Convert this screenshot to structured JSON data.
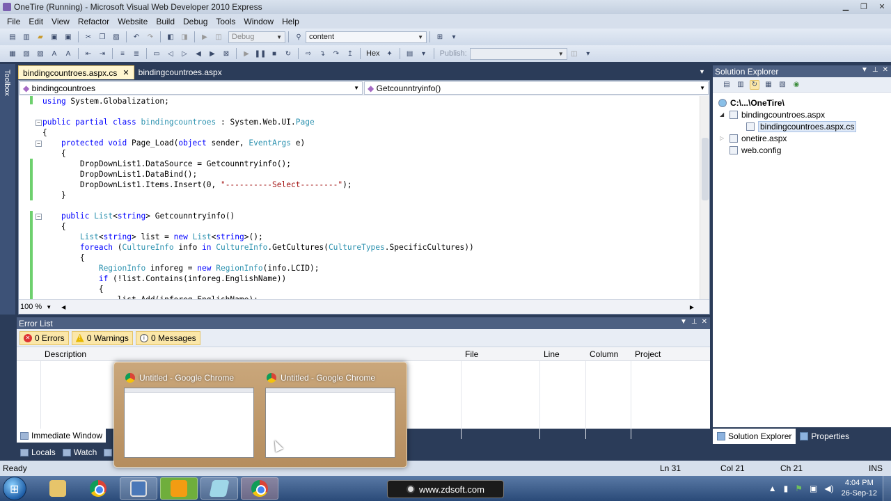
{
  "window": {
    "title": "OneTire (Running) - Microsoft Visual Web Developer 2010 Express"
  },
  "menu": [
    "File",
    "Edit",
    "View",
    "Refactor",
    "Website",
    "Build",
    "Debug",
    "Tools",
    "Window",
    "Help"
  ],
  "toolbar1": {
    "config": "Debug",
    "find_value": "content"
  },
  "toolbar2": {
    "hex_label": "Hex",
    "publish_label": "Publish:"
  },
  "toolbox_label": "Toolbox",
  "tabs": [
    {
      "label": "bindingcountroes.aspx.cs",
      "active": true
    },
    {
      "label": "bindingcountroes.aspx",
      "active": false
    }
  ],
  "navbar": {
    "class_combo": "bindingcountroes",
    "member_combo": "Getcounntryinfo()"
  },
  "code_lines": [
    "using System.Globalization;",
    "",
    "public partial class bindingcountroes : System.Web.UI.Page",
    "{",
    "    protected void Page_Load(object sender, EventArgs e)",
    "    {",
    "        DropDownList1.DataSource = Getcounntryinfo();",
    "        DropDownList1.DataBind();",
    "        DropDownList1.Items.Insert(0, \"----------Select--------\");",
    "    }",
    "",
    "    public List<string> Getcounntryinfo()",
    "    {",
    "        List<string> list = new List<string>();",
    "        foreach (CultureInfo info in CultureInfo.GetCultures(CultureTypes.SpecificCultures))",
    "        {",
    "            RegionInfo inforeg = new RegionInfo(info.LCID);",
    "            if (!list.Contains(inforeg.EnglishName))",
    "            {",
    "                list.Add(inforeg.EnglishName);"
  ],
  "editor": {
    "zoom": "100 %"
  },
  "solution_explorer": {
    "title": "Solution Explorer",
    "root": "C:\\...\\OneTire\\",
    "items": [
      "bindingcountroes.aspx",
      "bindingcountroes.aspx.cs",
      "onetire.aspx",
      "web.config"
    ],
    "tabs": [
      "Solution Explorer",
      "Properties"
    ]
  },
  "error_list": {
    "title": "Error List",
    "filters": [
      "0 Errors",
      "0 Warnings",
      "0 Messages"
    ],
    "columns": [
      "Description",
      "File",
      "Line",
      "Column",
      "Project"
    ]
  },
  "bottom_tabs": [
    "Immediate Window"
  ],
  "bottom_tabs2": [
    "Locals",
    "Watch"
  ],
  "thumbnails": [
    {
      "title": "Untitled - Google Chrome"
    },
    {
      "title": "Untitled - Google Chrome"
    }
  ],
  "status": {
    "ready": "Ready",
    "ln": "Ln 31",
    "col": "Col 21",
    "ch": "Ch 21",
    "ins": "INS"
  },
  "taskbar": {
    "watermark": "www.zdsoft.com",
    "time": "4:04 PM",
    "date": "26-Sep-12"
  }
}
